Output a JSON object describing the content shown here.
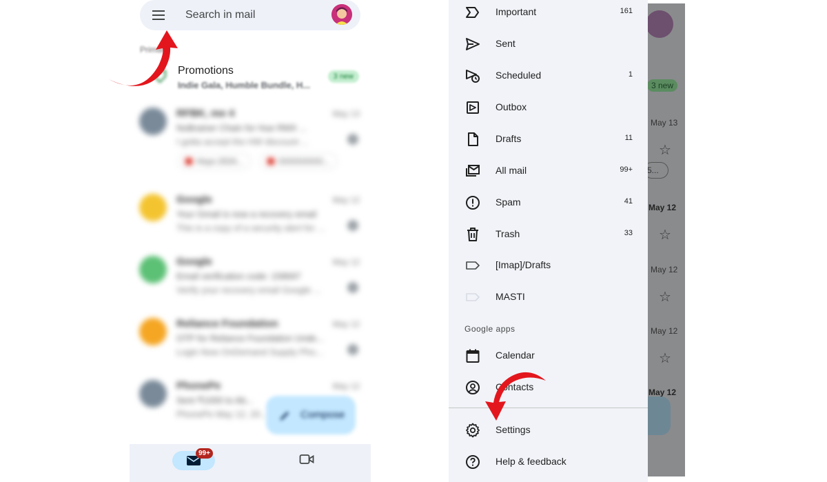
{
  "left_screen": {
    "search": {
      "placeholder": "Search in mail"
    },
    "primary_label": "Primary",
    "promotions": {
      "title": "Promotions",
      "subtitle": "Indie Gala, Humble Bundle, H...",
      "badge": "3 new"
    },
    "mails": [
      {
        "sender": "RFBK, me 4",
        "line1": "NoBrainer Chain for Hue RMX ...",
        "line2": "I gotta accept the HW discount ...",
        "date": "May 13",
        "avatar_color": "#7a8a99",
        "chips": [
          "Hoyo 2024...",
          "OOOOOOO..."
        ]
      },
      {
        "sender": "Google",
        "line1": "Your Gmail is now a recovery email",
        "line2": "This is a copy of a security alert for ...",
        "date": "May 12",
        "avatar_color": "#f4c430",
        "chips": []
      },
      {
        "sender": "Google",
        "line1": "Email verification code: 158697",
        "line2": "Verify your recovery email Google ...",
        "date": "May 12",
        "avatar_color": "#5cc075",
        "chips": []
      },
      {
        "sender": "Reliance Foundation",
        "line1": "OTP for Reliance Foundation Unde...",
        "line2": "Login Now OnDemand Supply Pho...",
        "date": "May 12",
        "avatar_color": "#f5a623",
        "chips": []
      },
      {
        "sender": "PhonePe",
        "line1": "Sent ₹1000 to Ab...",
        "line2": "PhonePe May 12, 20...",
        "date": "May 12",
        "avatar_color": "#7a8a99",
        "chips": []
      }
    ],
    "compose_label": "Compose",
    "bottom_nav": {
      "mail_badge": "99+"
    }
  },
  "drawer": {
    "items": [
      {
        "label": "Important",
        "count": "161",
        "icon": "important-icon"
      },
      {
        "label": "Sent",
        "count": "",
        "icon": "sent-icon"
      },
      {
        "label": "Scheduled",
        "count": "1",
        "icon": "scheduled-icon"
      },
      {
        "label": "Outbox",
        "count": "",
        "icon": "outbox-icon"
      },
      {
        "label": "Drafts",
        "count": "11",
        "icon": "drafts-icon"
      },
      {
        "label": "All mail",
        "count": "99+",
        "icon": "all-mail-icon"
      },
      {
        "label": "Spam",
        "count": "41",
        "icon": "spam-icon"
      },
      {
        "label": "Trash",
        "count": "33",
        "icon": "trash-icon"
      },
      {
        "label": "[Imap]/Drafts",
        "count": "",
        "icon": "label-icon"
      },
      {
        "label": "MASTI",
        "count": "",
        "icon": "label-light-icon"
      }
    ],
    "google_apps_label": "Google apps",
    "apps": [
      {
        "label": "Calendar",
        "icon": "calendar-icon"
      },
      {
        "label": "Contacts",
        "icon": "contacts-icon"
      }
    ],
    "bottom": [
      {
        "label": "Settings",
        "icon": "settings-icon"
      },
      {
        "label": "Help & feedback",
        "icon": "help-icon"
      }
    ]
  },
  "behind_drawer": {
    "badge": "3 new",
    "dates": [
      "May 13",
      "May 12",
      "May 12",
      "May 12",
      "May 12"
    ]
  },
  "colors": {
    "accent": "#c2e7ff",
    "badge_red": "#b3261e",
    "arrow_red": "#e3161d",
    "drawer_bg": "#f1f3f8"
  }
}
